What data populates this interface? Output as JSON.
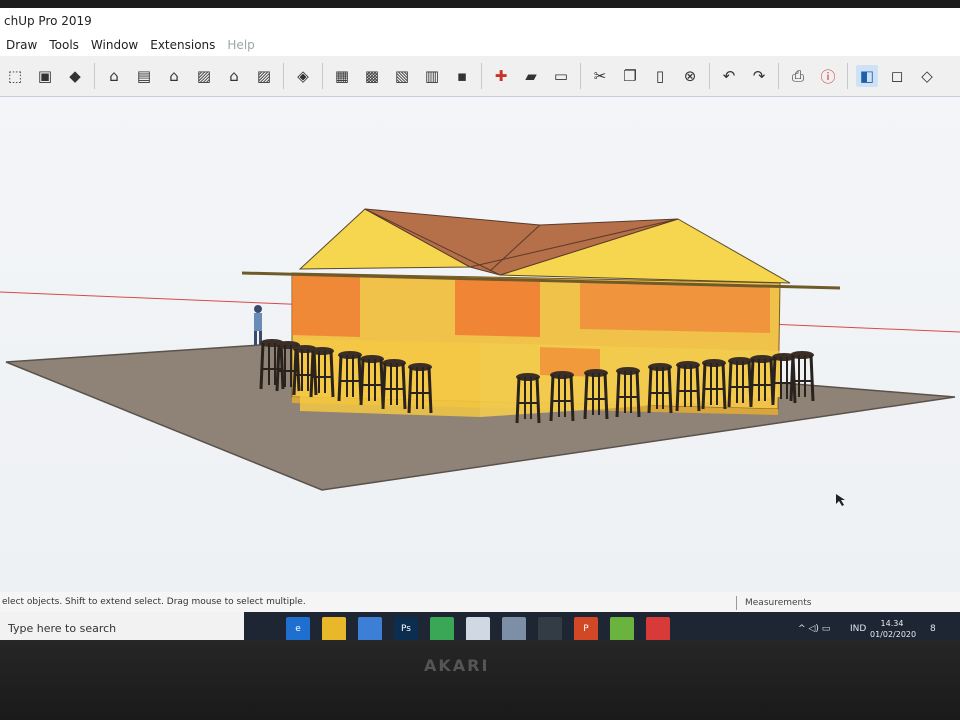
{
  "window": {
    "title": "chUp Pro 2019"
  },
  "menu": [
    {
      "label": "Draw",
      "dim": false
    },
    {
      "label": "Tools",
      "dim": false
    },
    {
      "label": "Window",
      "dim": false
    },
    {
      "label": "Extensions",
      "dim": false
    },
    {
      "label": "Help",
      "dim": true
    }
  ],
  "toolbar": {
    "icons": [
      "select-arrow-icon",
      "3d-warehouse-icon",
      "extension-warehouse-icon",
      "sep",
      "iso-view-icon",
      "top-view-icon",
      "front-view-icon",
      "right-view-icon",
      "back-view-icon",
      "left-view-icon",
      "sep",
      "wireframe-icon",
      "sep",
      "xray-icon",
      "hidden-line-icon",
      "shaded-icon",
      "shaded-texture-icon",
      "monochrome-icon",
      "sep",
      "new-file-icon",
      "open-file-icon",
      "save-icon",
      "sep",
      "cut-icon",
      "copy-icon",
      "paste-icon",
      "erase-icon",
      "sep",
      "undo-icon",
      "redo-icon",
      "sep",
      "print-icon",
      "model-info-icon",
      "sep",
      "component-front-icon",
      "component-back-icon",
      "component-edit-icon"
    ]
  },
  "status": {
    "message": "elect objects. Shift to extend select. Drag mouse to select multiple.",
    "measurements_label": "Measurements"
  },
  "taskbar": {
    "search_placeholder": "Type here to search",
    "apps": [
      {
        "name": "task-view-icon",
        "label": "",
        "color": "#1e2633"
      },
      {
        "name": "edge-icon",
        "label": "e",
        "color": "#1f6fd1"
      },
      {
        "name": "file-explorer-icon",
        "label": "",
        "color": "#e8b72a"
      },
      {
        "name": "store-icon",
        "label": "",
        "color": "#3d7fd6"
      },
      {
        "name": "photoshop-icon",
        "label": "Ps",
        "color": "#0b2d4f"
      },
      {
        "name": "chrome-icon",
        "label": "",
        "color": "#3aa757"
      },
      {
        "name": "whiteboard-icon",
        "label": "",
        "color": "#cfd8e3"
      },
      {
        "name": "network-drive-icon",
        "label": "",
        "color": "#7c8fa6"
      },
      {
        "name": "terminal-icon",
        "label": "",
        "color": "#333b45"
      },
      {
        "name": "powerpoint-icon",
        "label": "P",
        "color": "#d24726"
      },
      {
        "name": "layout-icon",
        "label": "",
        "color": "#6bb33f"
      },
      {
        "name": "sketchup-icon",
        "label": "",
        "color": "#d83a3a"
      }
    ],
    "tray_language": "IND",
    "time": "14.34",
    "date": "01/02/2020",
    "notification_count": "8"
  },
  "monitor": {
    "brand": "AKARI"
  }
}
